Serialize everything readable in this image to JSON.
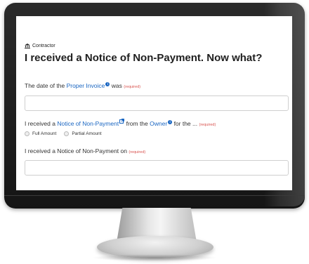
{
  "breadcrumb": {
    "icon": "bank-icon",
    "label": "Contractor"
  },
  "title": "I received a Notice of Non-Payment. Now what?",
  "q1": {
    "prefix": "The date of the",
    "link": "Proper Invoice",
    "info": "i",
    "suffix": "was",
    "required": "(required)",
    "value": ""
  },
  "q2": {
    "prefix": "I received a",
    "link1": "Notice of Non-Payment",
    "middle": "from the",
    "link2": "Owner",
    "info": "i",
    "suffix": "for the ...",
    "required": "(required)",
    "options": [
      "Full Amount",
      "Partial Amount"
    ]
  },
  "q3": {
    "prefix": "I received a Notice of Non-Payment on",
    "required": "(required)",
    "value": ""
  },
  "colors": {
    "link": "#1a66c2",
    "required": "#d9534f",
    "bezel": "#1a1a1a"
  }
}
